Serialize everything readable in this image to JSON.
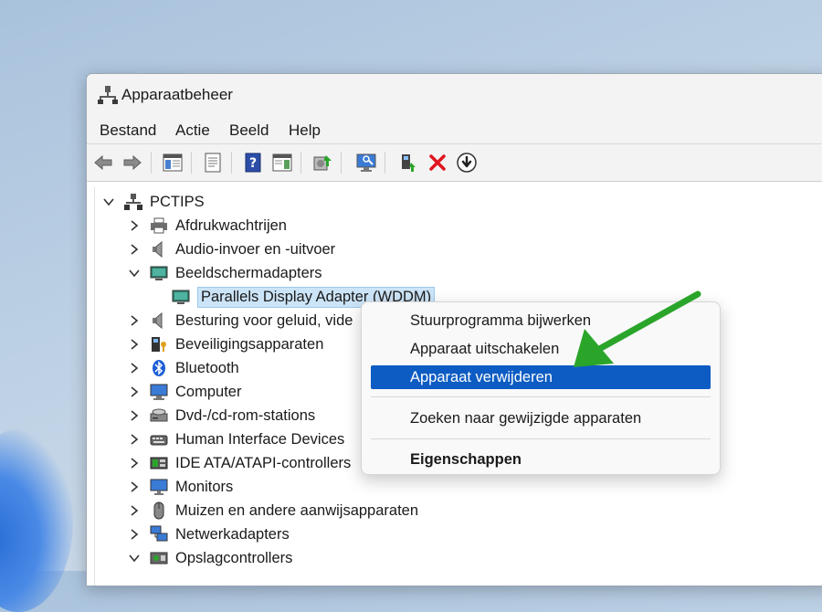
{
  "window": {
    "title": "Apparaatbeheer"
  },
  "menu": [
    "Bestand",
    "Actie",
    "Beeld",
    "Help"
  ],
  "toolbar": {
    "icons": [
      "back-arrow-icon",
      "forward-arrow-icon",
      "show-hide-console-tree-icon",
      "properties-icon",
      "help-icon",
      "action-pane-icon",
      "update-driver-icon",
      "scan-hardware-icon",
      "enable-device-icon",
      "uninstall-device-icon",
      "download-driver-icon"
    ],
    "accent_red": "#e0141e",
    "accent_blue": "#1e5ed6"
  },
  "tree": {
    "root": "PCTIPS",
    "items": [
      {
        "label": "Afdrukwachtrijen",
        "icon": "printer-icon",
        "expanded": false
      },
      {
        "label": "Audio-invoer en -uitvoer",
        "icon": "speaker-icon",
        "expanded": false
      },
      {
        "label": "Beeldschermadapters",
        "icon": "display-adapter-icon",
        "expanded": true
      },
      {
        "label": "Parallels Display Adapter (WDDM)",
        "icon": "display-adapter-icon",
        "child": true
      },
      {
        "label": "Besturing voor geluid, vide",
        "icon": "speaker-icon",
        "expanded": false
      },
      {
        "label": "Beveiligingsapparaten",
        "icon": "security-key-icon",
        "expanded": false
      },
      {
        "label": "Bluetooth",
        "icon": "bluetooth-icon",
        "expanded": false
      },
      {
        "label": "Computer",
        "icon": "computer-icon",
        "expanded": false
      },
      {
        "label": "Dvd-/cd-rom-stations",
        "icon": "dvd-drive-icon",
        "expanded": false
      },
      {
        "label": "Human Interface Devices",
        "icon": "hid-icon",
        "expanded": false
      },
      {
        "label": "IDE ATA/ATAPI-controllers",
        "icon": "ide-controller-icon",
        "expanded": false
      },
      {
        "label": "Monitors",
        "icon": "monitor-icon",
        "expanded": false
      },
      {
        "label": "Muizen en andere aanwijsapparaten",
        "icon": "mouse-icon",
        "expanded": false
      },
      {
        "label": "Netwerkadapters",
        "icon": "network-adapter-icon",
        "expanded": false
      },
      {
        "label": "Opslagcontrollers",
        "icon": "storage-controller-icon",
        "expanded": true
      }
    ]
  },
  "context_menu": {
    "items": [
      "Stuurprogramma bijwerken",
      "Apparaat uitschakelen",
      "Apparaat verwijderen",
      "Zoeken naar gewijzigde apparaten",
      "Eigenschappen"
    ],
    "highlighted": "Apparaat verwijderen",
    "highlight_color": "#0d5cc3"
  },
  "annotation": {
    "icon": "green-arrow-icon",
    "color": "#2aa52a"
  }
}
